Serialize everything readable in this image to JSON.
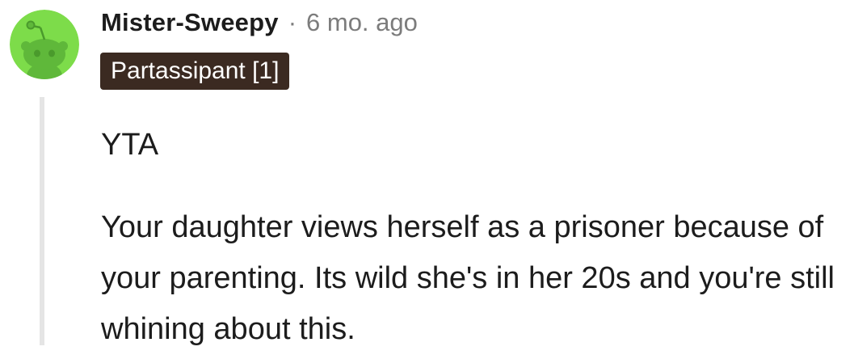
{
  "comment": {
    "author": "Mister-Sweepy",
    "separator": "·",
    "timestamp": "6 mo. ago",
    "flair": "Partassipant [1]",
    "verdict": "YTA",
    "body": "Your daughter views herself as a prisoner because of your parenting. Its wild she's in her 20s and you're still whining about this."
  },
  "colors": {
    "avatar_bg": "#7ddc4a",
    "flair_bg": "#3b2a21",
    "meta_text": "#7c7c7c",
    "thread_line": "#e5e5e5"
  },
  "icons": {
    "avatar": "snoo-avatar-icon"
  }
}
